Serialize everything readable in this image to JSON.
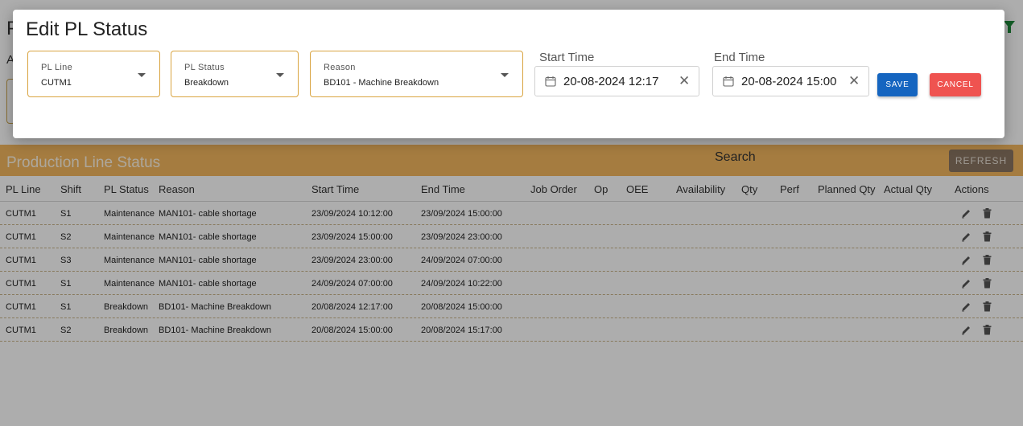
{
  "background": {
    "page_title": "P",
    "page_subtitle": "A",
    "panel": {
      "title": "Production Line Status",
      "search_label": "Search",
      "refresh_label": "REFRESH"
    },
    "table": {
      "headers": [
        "PL Line",
        "Shift",
        "PL Status",
        "Reason",
        "Start Time",
        "End Time",
        "Job Order",
        "Op",
        "OEE",
        "Availability",
        "Qty",
        "Perf",
        "Planned Qty",
        "Actual Qty",
        "Actions"
      ],
      "rows": [
        {
          "pl_line": "CUTM1",
          "shift": "S1",
          "status": "Maintenance",
          "reason": "MAN101- cable shortage",
          "start": "23/09/2024 10:12:00",
          "end": "23/09/2024 15:00:00"
        },
        {
          "pl_line": "CUTM1",
          "shift": "S2",
          "status": "Maintenance",
          "reason": "MAN101- cable shortage",
          "start": "23/09/2024 15:00:00",
          "end": "23/09/2024 23:00:00"
        },
        {
          "pl_line": "CUTM1",
          "shift": "S3",
          "status": "Maintenance",
          "reason": "MAN101- cable shortage",
          "start": "23/09/2024 23:00:00",
          "end": "24/09/2024 07:00:00"
        },
        {
          "pl_line": "CUTM1",
          "shift": "S1",
          "status": "Maintenance",
          "reason": "MAN101- cable shortage",
          "start": "24/09/2024 07:00:00",
          "end": "24/09/2024 10:22:00"
        },
        {
          "pl_line": "CUTM1",
          "shift": "S1",
          "status": "Breakdown",
          "reason": "BD101- Machine Breakdown",
          "start": "20/08/2024 12:17:00",
          "end": "20/08/2024 15:00:00"
        },
        {
          "pl_line": "CUTM1",
          "shift": "S2",
          "status": "Breakdown",
          "reason": "BD101- Machine Breakdown",
          "start": "20/08/2024 15:00:00",
          "end": "20/08/2024 15:17:00"
        }
      ]
    }
  },
  "dialog": {
    "title": "Edit PL Status",
    "pl_line": {
      "label": "PL Line",
      "value": "CUTM1"
    },
    "pl_status": {
      "label": "PL Status",
      "value": "Breakdown"
    },
    "reason": {
      "label": "Reason",
      "value": "BD101 - Machine Breakdown"
    },
    "start_time": {
      "label": "Start Time",
      "value": "20-08-2024 12:17"
    },
    "end_time": {
      "label": "End Time",
      "value": "20-08-2024 15:00"
    },
    "save_label": "SAVE",
    "cancel_label": "CANCEL"
  },
  "colors": {
    "accent_orange": "#f4b75f",
    "save_blue": "#1565c0",
    "cancel_red": "#ef5350",
    "select_border": "#d9a440"
  }
}
